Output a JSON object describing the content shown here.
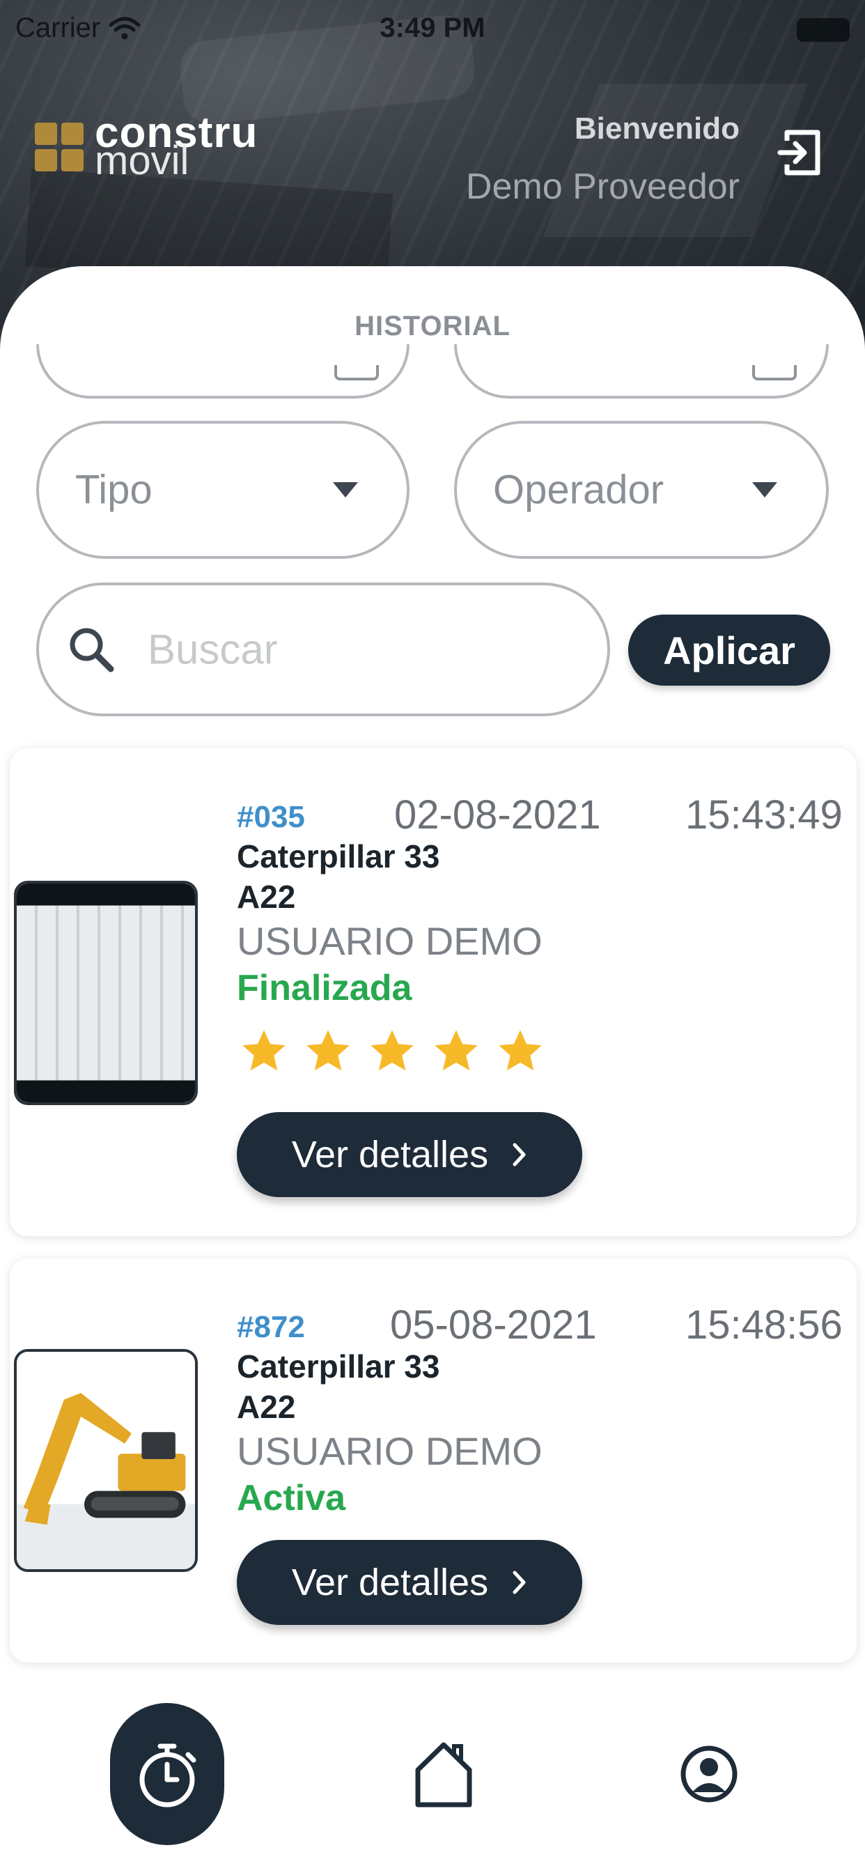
{
  "status_bar": {
    "carrier": "Carrier",
    "time": "3:49 PM"
  },
  "header": {
    "logo": {
      "line1": "constru",
      "line2": "movil"
    },
    "welcome": "Bienvenido",
    "user_name": "Demo Proveedor"
  },
  "screen_title": "HISTORIAL",
  "filters": {
    "tipo_label": "Tipo",
    "operador_label": "Operador",
    "search_placeholder": "Buscar",
    "apply_label": "Aplicar"
  },
  "orders": [
    {
      "id": "#035",
      "date": "02-08-2021",
      "time": "15:43:49",
      "model_line1": "Caterpillar 33",
      "model_line2": "A22",
      "user": "USUARIO DEMO",
      "status": "Finalizada",
      "rating": 5,
      "details_label": "Ver detalles"
    },
    {
      "id": "#872",
      "date": "05-08-2021",
      "time": "15:48:56",
      "model_line1": "Caterpillar 33",
      "model_line2": "A22",
      "user": "USUARIO DEMO",
      "status": "Activa",
      "details_label": "Ver detalles"
    }
  ],
  "colors": {
    "primary": "#1e2b38",
    "id_blue": "#3f8fc9",
    "status_green": "#27a84e",
    "star_yellow": "#f6b928",
    "logo_gold": "#b08a3b"
  },
  "bottom_nav": {
    "items": [
      {
        "icon": "stopwatch-icon",
        "active": true
      },
      {
        "icon": "home-icon",
        "active": false
      },
      {
        "icon": "profile-icon",
        "active": false
      }
    ]
  }
}
